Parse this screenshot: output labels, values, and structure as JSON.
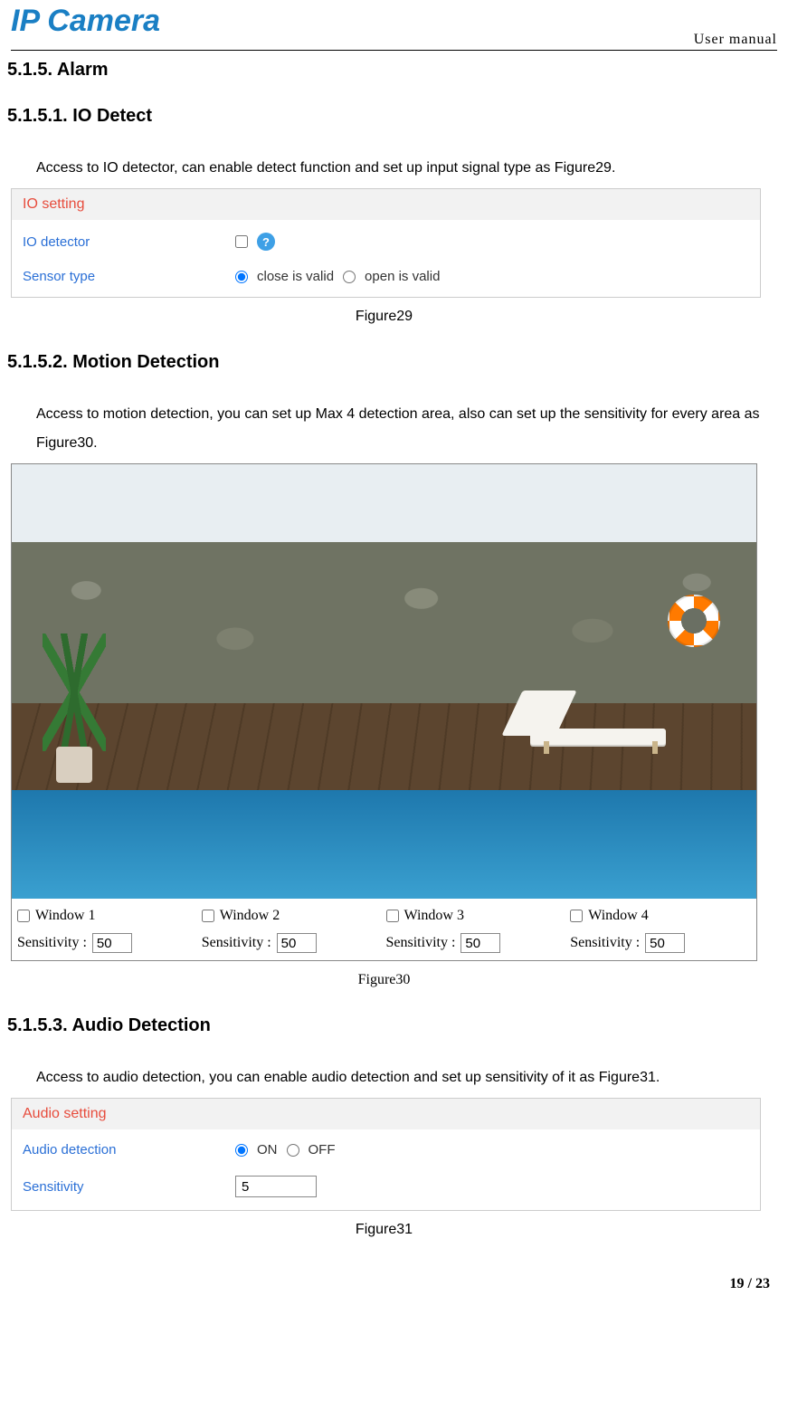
{
  "header": {
    "logo": "IP Camera",
    "label": "User manual"
  },
  "sections": {
    "s515": "5.1.5.  Alarm",
    "s5151": "5.1.5.1. IO Detect",
    "s5151_body": "Access to IO detector, can enable detect function and set up input signal type as Figure29.",
    "fig29_caption": "Figure29",
    "s5152": "5.1.5.2. Motion Detection",
    "s5152_body": "Access to motion detection, you can set up Max 4 detection area, also can set up the sensitivity for every area as Figure30.",
    "fig30_caption": "Figure30",
    "s5153": "5.1.5.3. Audio Detection",
    "s5153_body": "Access to audio detection, you can enable audio detection and set up sensitivity of it as Figure31.",
    "fig31_caption": "Figure31"
  },
  "fig29": {
    "title": "IO setting",
    "row1_label": "IO detector",
    "row1_checked": false,
    "row2_label": "Sensor type",
    "opt_close": "close is valid",
    "opt_open": "open is valid"
  },
  "fig30": {
    "windows": [
      {
        "label": "Window 1",
        "sens_label": "Sensitivity :",
        "value": "50"
      },
      {
        "label": "Window 2",
        "sens_label": "Sensitivity :",
        "value": "50"
      },
      {
        "label": "Window 3",
        "sens_label": "Sensitivity :",
        "value": "50"
      },
      {
        "label": "Window 4",
        "sens_label": "Sensitivity :",
        "value": "50"
      }
    ]
  },
  "fig31": {
    "title": "Audio setting",
    "row1_label": "Audio detection",
    "on": "ON",
    "off": "OFF",
    "row2_label": "Sensitivity",
    "value": "5"
  },
  "page": "19 / 23"
}
